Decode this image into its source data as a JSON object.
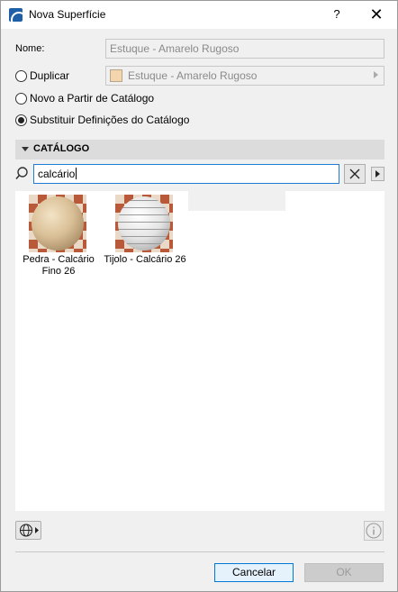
{
  "window": {
    "title": "Nova Superfície",
    "help_glyph": "?",
    "close_glyph": "✕"
  },
  "form": {
    "name_label": "Nome:",
    "name_value": "Estuque - Amarelo Rugoso",
    "options": [
      {
        "label": "Duplicar",
        "checked": false
      },
      {
        "label": "Novo a Partir de Catálogo",
        "checked": false
      },
      {
        "label": "Substituir Definições do Catálogo",
        "checked": true
      }
    ],
    "duplicate_value": "Estuque - Amarelo Rugoso",
    "duplicate_swatch_color": "#f3d6ae"
  },
  "catalog": {
    "title": "CATÁLOGO",
    "search_value": "calcário",
    "results": [
      {
        "label": "Pedra - Calcário Fino 26",
        "icon": "stone-sphere"
      },
      {
        "label": "Tijolo - Calcário 26",
        "icon": "brick-sphere"
      }
    ]
  },
  "buttons": {
    "cancel": "Cancelar",
    "ok": "OK"
  },
  "colors": {
    "accent": "#0078d7",
    "focus_border": "#1e7bd6"
  }
}
